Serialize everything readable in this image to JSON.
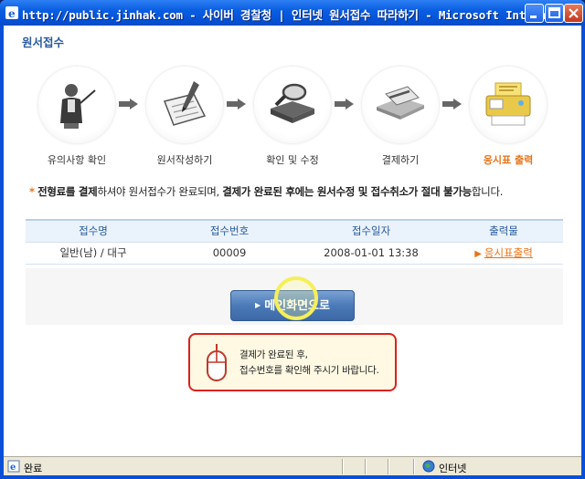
{
  "window": {
    "title": "http://public.jinhak.com - 사이버 경찰청 | 인터넷 원서접수 따라하기 - Microsoft Intern..."
  },
  "page": {
    "title": "원서접수"
  },
  "steps": [
    {
      "label": "유의사항 확인",
      "icon": "presenter-icon"
    },
    {
      "label": "원서작성하기",
      "icon": "form-pen-icon"
    },
    {
      "label": "확인 및 수정",
      "icon": "magnifier-book-icon"
    },
    {
      "label": "결제하기",
      "icon": "card-payment-icon"
    },
    {
      "label": "응시표 출력",
      "icon": "printer-icon",
      "active": true
    }
  ],
  "notice": {
    "asterisk": "*",
    "p1": "전형료를 결제",
    "p2": "하셔야 원서접수가 완료되며, ",
    "p3": "결제가 완료된 후에는 원서수정 및 접수취소가 절대 불가능",
    "p4": "합니다."
  },
  "table": {
    "headers": [
      "접수명",
      "접수번호",
      "접수일자",
      "출력물"
    ],
    "rows": [
      {
        "name": "일반(남) / 대구",
        "number": "00009",
        "date": "2008-01-01 13:38",
        "output": "응시표출력"
      }
    ]
  },
  "main_button": {
    "label": "메인화면으로"
  },
  "info": {
    "line1": "결제가 완료된 후,",
    "line2": "접수번호를 확인해 주시기 바랍니다."
  },
  "status": {
    "text": "완료",
    "zone": "인터넷"
  },
  "colors": {
    "accent": "#e8741a",
    "brand_blue": "#2a5b9e",
    "alert_red": "#d8231f"
  }
}
